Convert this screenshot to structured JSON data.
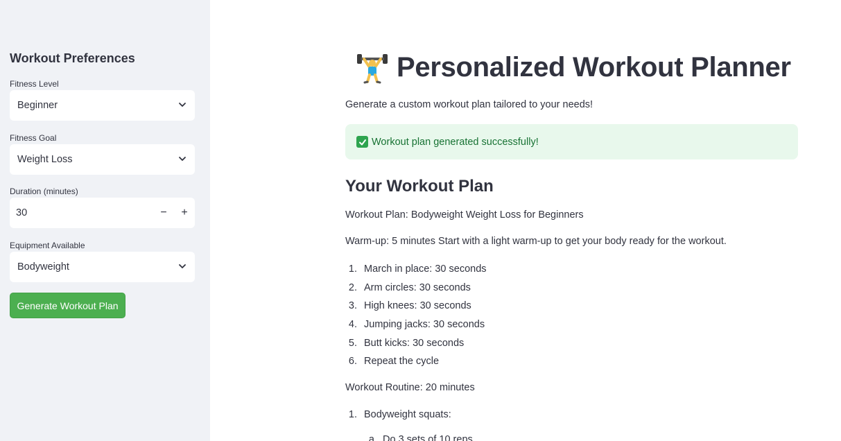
{
  "sidebar": {
    "heading": "Workout Preferences",
    "fitness_level": {
      "label": "Fitness Level",
      "value": "Beginner"
    },
    "fitness_goal": {
      "label": "Fitness Goal",
      "value": "Weight Loss"
    },
    "duration": {
      "label": "Duration (minutes)",
      "value": "30",
      "minus": "−",
      "plus": "+"
    },
    "equipment": {
      "label": "Equipment Available",
      "value": "Bodyweight"
    },
    "generate_button": "Generate Workout Plan"
  },
  "main": {
    "title": "Personalized Workout Planner",
    "title_icon": "weightlifter-emoji",
    "subtitle": "Generate a custom workout plan tailored to your needs!",
    "success_message": "Workout plan generated successfully!",
    "section_heading": "Your Workout Plan",
    "plan_title": "Workout Plan: Bodyweight Weight Loss for Beginners",
    "warmup": "Warm-up: 5 minutes Start with a light warm-up to get your body ready for the workout.",
    "warmup_steps": [
      {
        "n": "1.",
        "text": "March in place: 30 seconds"
      },
      {
        "n": "2.",
        "text": "Arm circles: 30 seconds"
      },
      {
        "n": "3.",
        "text": "High knees: 30 seconds"
      },
      {
        "n": "4.",
        "text": "Jumping jacks: 30 seconds"
      },
      {
        "n": "5.",
        "text": "Butt kicks: 30 seconds"
      },
      {
        "n": "6.",
        "text": "Repeat the cycle"
      }
    ],
    "routine": "Workout Routine: 20 minutes",
    "routine_steps": [
      {
        "n": "1.",
        "text": "Bodyweight squats:"
      }
    ],
    "routine_substeps": [
      {
        "n": "a.",
        "text": "Do 3 sets of 10 reps"
      }
    ]
  },
  "colors": {
    "sidebar_bg": "#f0f2f6",
    "button_green": "#4caf50",
    "success_bg": "#e8f8ec",
    "success_text": "#177233"
  }
}
